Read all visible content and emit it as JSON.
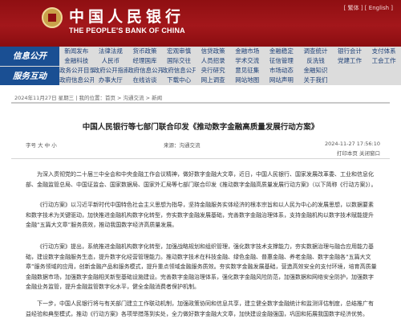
{
  "header": {
    "title_cn": "中国人民银行",
    "title_en": "THE PEOPLE'S BANK OF CHINA",
    "top_links": "[ 繁体 ]  [ English ]"
  },
  "nav": {
    "section_info": "信息公开",
    "section_service": "服务互动",
    "row1": [
      [
        "新闻发布",
        "金融科技"
      ],
      [
        "法律法规",
        "人民币"
      ],
      [
        "货币政策",
        "经理国库"
      ],
      [
        "宏观审慎",
        "国际交往"
      ],
      [
        "信贷政策",
        "人员招录"
      ],
      [
        "金融市场",
        "学术交流"
      ],
      [
        "金融稳定",
        "征信管理"
      ],
      [
        "调查统计",
        "反洗钱"
      ],
      [
        "银行会计",
        "党建工作"
      ],
      [
        "支付体系",
        "工会工作"
      ]
    ],
    "row2": [
      [
        "政务公开目录",
        "政府信息公开"
      ],
      [
        "政府公开指南",
        "办事大厅"
      ],
      [
        "政府信息公开",
        "在线访谈"
      ],
      [
        "政府信息公开",
        "下载中心"
      ],
      [
        "央行研究",
        "网上调查"
      ],
      [
        "意见征集",
        "网站地图"
      ],
      [
        "市场动态",
        "网站声明"
      ],
      [
        "金融知识",
        "关于我们"
      ],
      [
        "",
        ""
      ],
      [
        "",
        ""
      ]
    ]
  },
  "breadcrumb": "2024年11月27日 星期三 | 我的位置：首页 > 沟通交流 > 新闻",
  "article": {
    "title": "中国人民银行等七部门联合印发《推动数字金融高质量发展行动方案》",
    "meta_left": "字号  大  中  小",
    "meta_mid": "来源：沟通交流",
    "meta_date": "2024-11-27  17:56:10",
    "meta_font": "打印本页  关闭窗口",
    "paragraphs": [
      "为深入贯彻党的二十届三中全会和中央金融工作会议精神，做好数字金融大文章，近日，中国人民银行、国家发展改革委、工业和信息化部、金融监管总局、中国证监会、国家数据局、国家外汇局等七部门联合印发《推动数字金融高质量发展行动方案》（以下简称《行动方案》）。",
      "《行动方案》以习近平新时代中国特色社会主义思想为指导，坚持金融服务实体经济的根本宗旨和以人民为中心的发展思想，以数据要素和数字技术为关键驱动，加快推进金融机构数字化转型，夯实数字金融发展基础，完善数字金融治理体系，支持金融机构以数字技术赋能提升金融“五篇大文章”服务质效，推动我国数字经济高质量发展。",
      "《行动方案》提出，系统推进金融机构数字化转型，加强战略规划和组织管理，强化数字技术支撑能力，夯实数据治理与融合应用能力基础，建设数字金融服务生态，提升数字化经营管理能力。推动数字技术在科技金融、绿色金融、普惠金融、养老金融、数字金融各“五篇大文章”服务领域的应用，创新金融产品和服务模式，提升重点领域金融服务质效。夯实数字金融发展基础，营造高效安全的支付环境，培育高质量金融数据市场，加强数字金融相关新型基础设施建设。完善数字金融治理体系，强化数字金融风险防范，加强数据和网络安全防护，加强数字金融业务监管，提升金融监管数字化水平，健全金融消费者保护机制。",
      "下一步，中国人民银行将与有关部门建立工作联动机制，加强政策协同和信息共享，建立健全数字金融统计和监测评估制度，总结推广有益经验和典型模式，推动《行动方案》各项举措落到实处，全力做好数字金融大文章，加快建设金融强国，巩固和拓展我国数字经济优势。"
    ]
  }
}
